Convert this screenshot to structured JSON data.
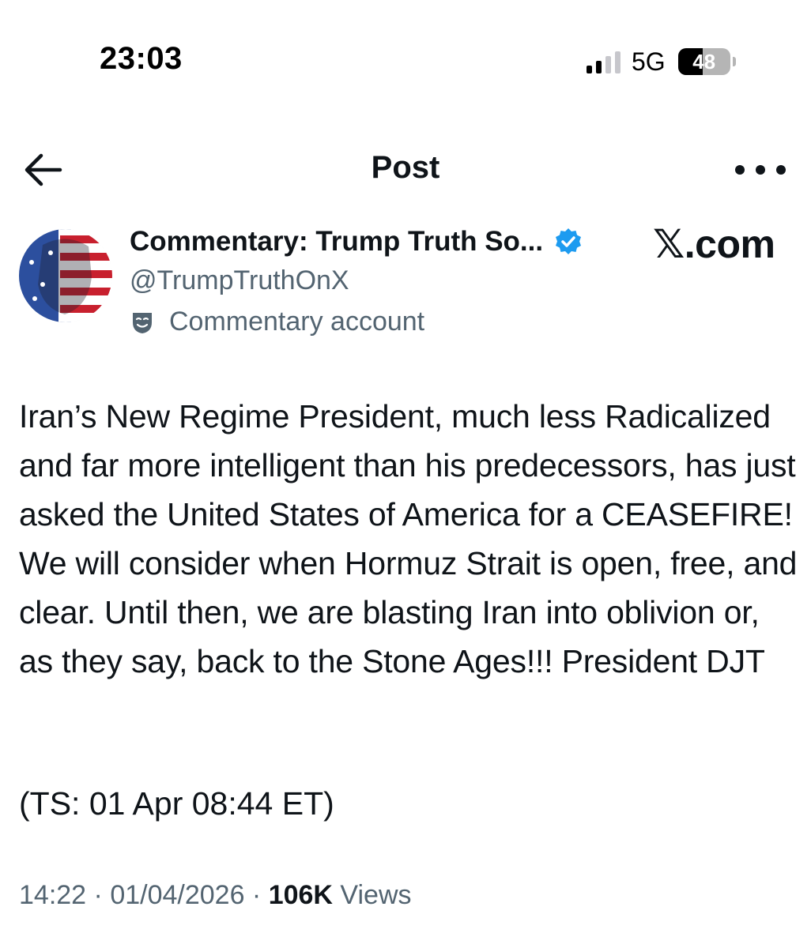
{
  "status_bar": {
    "time": "23:03",
    "network": "5G",
    "battery_level": "48",
    "battery_fraction": 0.48
  },
  "header": {
    "title": "Post",
    "back_icon": "arrow-left-icon",
    "more_icon": "more-horizontal-icon"
  },
  "author": {
    "display_name": "Commentary: Trump Truth So...",
    "handle": "@TrumpTruthOnX",
    "account_label": "Commentary account",
    "verified": true,
    "verified_color": "#1d9bf0"
  },
  "watermark": "𝕏.com",
  "post": {
    "text": "Iran’s New Regime President, much less Radicalized and far more intelligent than his predecessors, has just asked the United States of America for a CEASEFIRE! We will consider when Hormuz Strait is open, free, and clear. Until then, we are blasting Iran into oblivion or, as they say, back to the Stone Ages!!! President DJT",
    "timestamp_note": "(TS: 01 Apr 08:44 ET)"
  },
  "meta": {
    "time": "14:22",
    "separator": " · ",
    "date": "01/04/2026",
    "views_count": "106K",
    "views_label": " Views"
  },
  "colors": {
    "text_primary": "#0f1419",
    "text_secondary": "#536471",
    "accent": "#1d9bf0"
  }
}
